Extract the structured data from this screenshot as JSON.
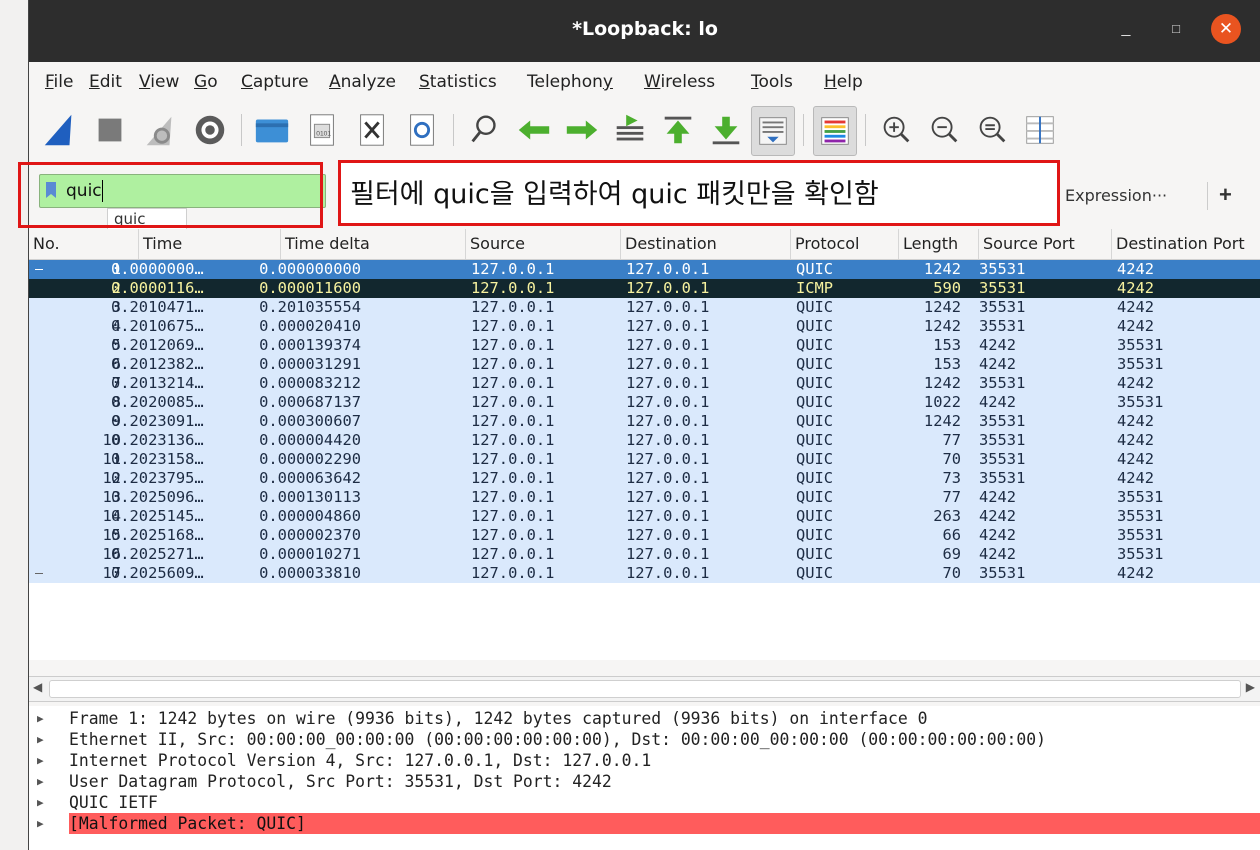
{
  "window": {
    "title": "*Loopback: lo",
    "minimize": "_",
    "maximize": "□",
    "close": "✕"
  },
  "menu": [
    {
      "u": "F",
      "rest": "ile"
    },
    {
      "u": "E",
      "rest": "dit"
    },
    {
      "u": "V",
      "rest": "iew"
    },
    {
      "u": "G",
      "rest": "o"
    },
    {
      "u": "C",
      "rest": "apture"
    },
    {
      "u": "A",
      "rest": "nalyze"
    },
    {
      "u": "S",
      "rest": "tatistics"
    },
    {
      "pre": "Telephon",
      "u": "y",
      "rest": ""
    },
    {
      "u": "W",
      "rest": "ireless"
    },
    {
      "u": "T",
      "rest": "ools"
    },
    {
      "u": "H",
      "rest": "elp"
    }
  ],
  "toolbar_icons": [
    "shark-fin-icon",
    "stop-icon",
    "restart-icon",
    "options-gear-icon",
    "open-folder-icon",
    "save-file-icon",
    "close-file-icon",
    "reload-icon",
    "find-icon",
    "back-arrow-icon",
    "forward-arrow-icon",
    "go-to-packet-icon",
    "first-packet-icon",
    "last-packet-icon",
    "autoscroll-icon",
    "colorize-icon",
    "zoom-in-icon",
    "zoom-out-icon",
    "normal-size-icon",
    "resize-columns-icon"
  ],
  "filter": {
    "value": "quic",
    "suggestion": "quic",
    "expression_label": "Expression···",
    "add_label": "+"
  },
  "annotation": {
    "text": "필터에 quic을 입력하여 quic 패킷만을 확인함"
  },
  "columns": [
    "No.",
    "Time",
    "Time delta",
    "Source",
    "Destination",
    "Protocol",
    "Length",
    "Source Port",
    "Destination Port"
  ],
  "packets": [
    {
      "no": "1",
      "time": "0.0000000…",
      "delta": "0.000000000",
      "src": "127.0.0.1",
      "dst": "127.0.0.1",
      "proto": "QUIC",
      "len": "1242",
      "sport": "35531",
      "dport": "4242"
    },
    {
      "no": "2",
      "time": "0.0000116…",
      "delta": "0.000011600",
      "src": "127.0.0.1",
      "dst": "127.0.0.1",
      "proto": "ICMP",
      "len": "590",
      "sport": "35531",
      "dport": "4242"
    },
    {
      "no": "3",
      "time": "0.2010471…",
      "delta": "0.201035554",
      "src": "127.0.0.1",
      "dst": "127.0.0.1",
      "proto": "QUIC",
      "len": "1242",
      "sport": "35531",
      "dport": "4242"
    },
    {
      "no": "4",
      "time": "0.2010675…",
      "delta": "0.000020410",
      "src": "127.0.0.1",
      "dst": "127.0.0.1",
      "proto": "QUIC",
      "len": "1242",
      "sport": "35531",
      "dport": "4242"
    },
    {
      "no": "5",
      "time": "0.2012069…",
      "delta": "0.000139374",
      "src": "127.0.0.1",
      "dst": "127.0.0.1",
      "proto": "QUIC",
      "len": "153",
      "sport": "4242",
      "dport": "35531"
    },
    {
      "no": "6",
      "time": "0.2012382…",
      "delta": "0.000031291",
      "src": "127.0.0.1",
      "dst": "127.0.0.1",
      "proto": "QUIC",
      "len": "153",
      "sport": "4242",
      "dport": "35531"
    },
    {
      "no": "7",
      "time": "0.2013214…",
      "delta": "0.000083212",
      "src": "127.0.0.1",
      "dst": "127.0.0.1",
      "proto": "QUIC",
      "len": "1242",
      "sport": "35531",
      "dport": "4242"
    },
    {
      "no": "8",
      "time": "0.2020085…",
      "delta": "0.000687137",
      "src": "127.0.0.1",
      "dst": "127.0.0.1",
      "proto": "QUIC",
      "len": "1022",
      "sport": "4242",
      "dport": "35531"
    },
    {
      "no": "9",
      "time": "0.2023091…",
      "delta": "0.000300607",
      "src": "127.0.0.1",
      "dst": "127.0.0.1",
      "proto": "QUIC",
      "len": "1242",
      "sport": "35531",
      "dport": "4242"
    },
    {
      "no": "10",
      "time": "0.2023136…",
      "delta": "0.000004420",
      "src": "127.0.0.1",
      "dst": "127.0.0.1",
      "proto": "QUIC",
      "len": "77",
      "sport": "35531",
      "dport": "4242"
    },
    {
      "no": "11",
      "time": "0.2023158…",
      "delta": "0.000002290",
      "src": "127.0.0.1",
      "dst": "127.0.0.1",
      "proto": "QUIC",
      "len": "70",
      "sport": "35531",
      "dport": "4242"
    },
    {
      "no": "12",
      "time": "0.2023795…",
      "delta": "0.000063642",
      "src": "127.0.0.1",
      "dst": "127.0.0.1",
      "proto": "QUIC",
      "len": "73",
      "sport": "35531",
      "dport": "4242"
    },
    {
      "no": "13",
      "time": "0.2025096…",
      "delta": "0.000130113",
      "src": "127.0.0.1",
      "dst": "127.0.0.1",
      "proto": "QUIC",
      "len": "77",
      "sport": "4242",
      "dport": "35531"
    },
    {
      "no": "14",
      "time": "0.2025145…",
      "delta": "0.000004860",
      "src": "127.0.0.1",
      "dst": "127.0.0.1",
      "proto": "QUIC",
      "len": "263",
      "sport": "4242",
      "dport": "35531"
    },
    {
      "no": "15",
      "time": "0.2025168…",
      "delta": "0.000002370",
      "src": "127.0.0.1",
      "dst": "127.0.0.1",
      "proto": "QUIC",
      "len": "66",
      "sport": "4242",
      "dport": "35531"
    },
    {
      "no": "16",
      "time": "0.2025271…",
      "delta": "0.000010271",
      "src": "127.0.0.1",
      "dst": "127.0.0.1",
      "proto": "QUIC",
      "len": "69",
      "sport": "4242",
      "dport": "35531"
    },
    {
      "no": "17",
      "time": "0.2025609…",
      "delta": "0.000033810",
      "src": "127.0.0.1",
      "dst": "127.0.0.1",
      "proto": "QUIC",
      "len": "70",
      "sport": "35531",
      "dport": "4242"
    }
  ],
  "details": [
    "Frame 1: 1242 bytes on wire (9936 bits), 1242 bytes captured (9936 bits) on interface 0",
    "Ethernet II, Src: 00:00:00_00:00:00 (00:00:00:00:00:00), Dst: 00:00:00_00:00:00 (00:00:00:00:00:00)",
    "Internet Protocol Version 4, Src: 127.0.0.1, Dst: 127.0.0.1",
    "User Datagram Protocol, Src Port: 35531, Dst Port: 4242",
    "QUIC IETF",
    "[Malformed Packet: QUIC]"
  ],
  "colors": {
    "selected_row": "#3a7fc7",
    "icmp_row": "#12272e",
    "quic_row": "#dae9fc",
    "malformed": "#ff5c5c",
    "filter_valid": "#aff0a0",
    "annotation_red": "#e01616"
  }
}
